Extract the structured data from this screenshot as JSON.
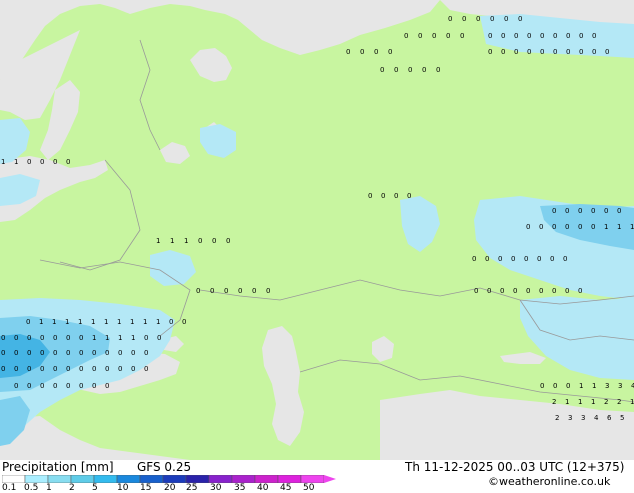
{
  "product_label": "Precipitation [mm]",
  "model_label": "GFS 0.25",
  "valid_time": "Th 11-12-2025 00..03 UTC (12+375)",
  "copyright": "©weatheronline.co.uk",
  "legend": {
    "ticks": [
      "0.1",
      "0.5",
      "1",
      "2",
      "5",
      "10",
      "15",
      "20",
      "25",
      "30",
      "35",
      "40",
      "45",
      "50"
    ],
    "colors": [
      "#ffffff",
      "#aaeeff",
      "#88ddf0",
      "#5fcce8",
      "#33bbee",
      "#1a88dd",
      "#1860cc",
      "#1c3cbb",
      "#2a22aa",
      "#8822cc",
      "#aa22cc",
      "#cc22cc",
      "#dd22dd",
      "#ee44ee"
    ]
  },
  "colors": {
    "land": "#c8f5a0",
    "sea": "#e6e6e6",
    "border": "#999999",
    "precip_light": "#b4e8f6",
    "precip_mid": "#7fd0ee",
    "precip_heavy": "#44b4e4"
  },
  "values": [
    "0",
    "0",
    "0",
    "0",
    "0",
    "0",
    "0",
    "0",
    "0",
    "0",
    "0",
    "0",
    "0",
    "0",
    "0",
    "0",
    "0",
    "0",
    "0",
    "0",
    "0",
    "0",
    "0",
    "0",
    "0",
    "0",
    "0",
    "0",
    "0",
    "0",
    "0",
    "0",
    "0",
    "0",
    "0",
    "0",
    "0",
    "0",
    "0",
    "1",
    "1",
    "0",
    "0",
    "0",
    "0",
    "0",
    "0",
    "0",
    "0",
    "0",
    "0",
    "0",
    "0",
    "0",
    "0",
    "0",
    "0",
    "0",
    "0",
    "0",
    "0",
    "1",
    "1",
    "1",
    "1",
    "1",
    "1",
    "1",
    "0",
    "0",
    "0",
    "0",
    "0",
    "0",
    "0",
    "0",
    "0",
    "0",
    "0",
    "0",
    "0",
    "0",
    "0",
    "0",
    "0",
    "0",
    "0",
    "0",
    "0",
    "0",
    "0",
    "0",
    "0",
    "0",
    "0",
    "1",
    "1",
    "1",
    "1",
    "1",
    "1",
    "1",
    "1",
    "1",
    "1",
    "0",
    "0",
    "0",
    "0",
    "0",
    "0",
    "0",
    "0",
    "0",
    "1",
    "1",
    "1",
    "1",
    "0",
    "0",
    "0",
    "0",
    "0",
    "0",
    "0",
    "0",
    "0",
    "0",
    "0",
    "0",
    "0",
    "0",
    "0",
    "0",
    "0",
    "0",
    "0",
    "0",
    "0",
    "0",
    "0",
    "0",
    "0",
    "0",
    "0",
    "0",
    "0",
    "0",
    "0",
    "0",
    "0",
    "0",
    "0",
    "0",
    "0",
    "1",
    "1",
    "3",
    "3",
    "4",
    "2",
    "1",
    "1",
    "1",
    "2",
    "2",
    "1",
    "2",
    "2",
    "3",
    "3",
    "4",
    "6",
    "5",
    "3",
    "3",
    "2",
    "3",
    "2",
    "2",
    "3",
    "0",
    "1",
    "1",
    "2",
    "3",
    "3",
    "2",
    "2",
    "2",
    "2",
    "3",
    "1",
    "2",
    "2",
    "0",
    "2",
    "2",
    "1",
    "0",
    "0",
    "0",
    "0",
    "0",
    "0",
    "0",
    "0",
    "0",
    "1",
    "0",
    "0",
    "0",
    "0",
    "0",
    "0",
    "0",
    "0",
    "0",
    "0",
    "1",
    "1",
    "0",
    "1",
    "0",
    "0",
    "0",
    "0"
  ]
}
